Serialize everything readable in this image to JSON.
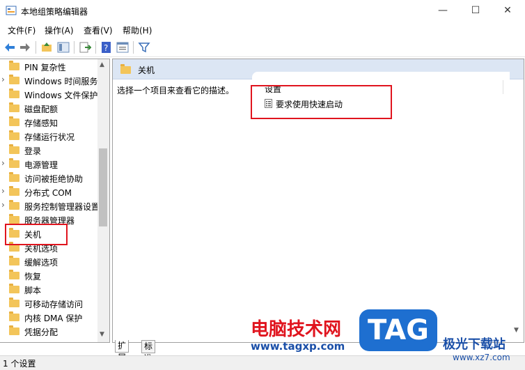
{
  "window": {
    "title": "本地组策略编辑器",
    "controls": {
      "minimize": "—",
      "maximize": "☐",
      "close": "✕"
    }
  },
  "menubar": [
    "文件(F)",
    "操作(A)",
    "查看(V)",
    "帮助(H)"
  ],
  "toolbar": {
    "icons": [
      "back-arrow-icon",
      "forward-arrow-icon",
      "up-folder-icon",
      "show-hide-tree-icon",
      "export-list-icon",
      "help-icon",
      "show-properties-icon",
      "filter-icon"
    ]
  },
  "tree": {
    "items": [
      {
        "label": "PIN 复杂性",
        "expandable": false
      },
      {
        "label": "Windows 时间服务",
        "expandable": true
      },
      {
        "label": "Windows 文件保护",
        "expandable": false
      },
      {
        "label": "磁盘配额",
        "expandable": false
      },
      {
        "label": "存储感知",
        "expandable": false
      },
      {
        "label": "存储运行状况",
        "expandable": false
      },
      {
        "label": "登录",
        "expandable": false
      },
      {
        "label": "电源管理",
        "expandable": true
      },
      {
        "label": "访问被拒绝协助",
        "expandable": false
      },
      {
        "label": "分布式 COM",
        "expandable": true
      },
      {
        "label": "服务控制管理器设置",
        "expandable": true
      },
      {
        "label": "服务器管理器",
        "expandable": false
      },
      {
        "label": "关机",
        "expandable": false,
        "selected": true
      },
      {
        "label": "关机选项",
        "expandable": false
      },
      {
        "label": "缓解选项",
        "expandable": false
      },
      {
        "label": "恢复",
        "expandable": false
      },
      {
        "label": "脚本",
        "expandable": false
      },
      {
        "label": "可移动存储访问",
        "expandable": false
      },
      {
        "label": "内核 DMA 保护",
        "expandable": false
      },
      {
        "label": "凭据分配",
        "expandable": false
      }
    ]
  },
  "right": {
    "header": "关机",
    "description": "选择一个项目来查看它的描述。",
    "column_header": "设置",
    "policies": [
      "要求使用快速启动"
    ]
  },
  "tabs": [
    "扩展",
    "标准"
  ],
  "status": "1 个设置",
  "colors": {
    "highlight_red": "#e0141e",
    "folder": "#f3c55a",
    "header_blue": "#dce6f4"
  },
  "watermark": {
    "cn_text": "电脑技术网",
    "url": "www.tagxp.com",
    "badge": "TAG",
    "site": "极光下载站",
    "site_url": "www.xz7.com"
  }
}
